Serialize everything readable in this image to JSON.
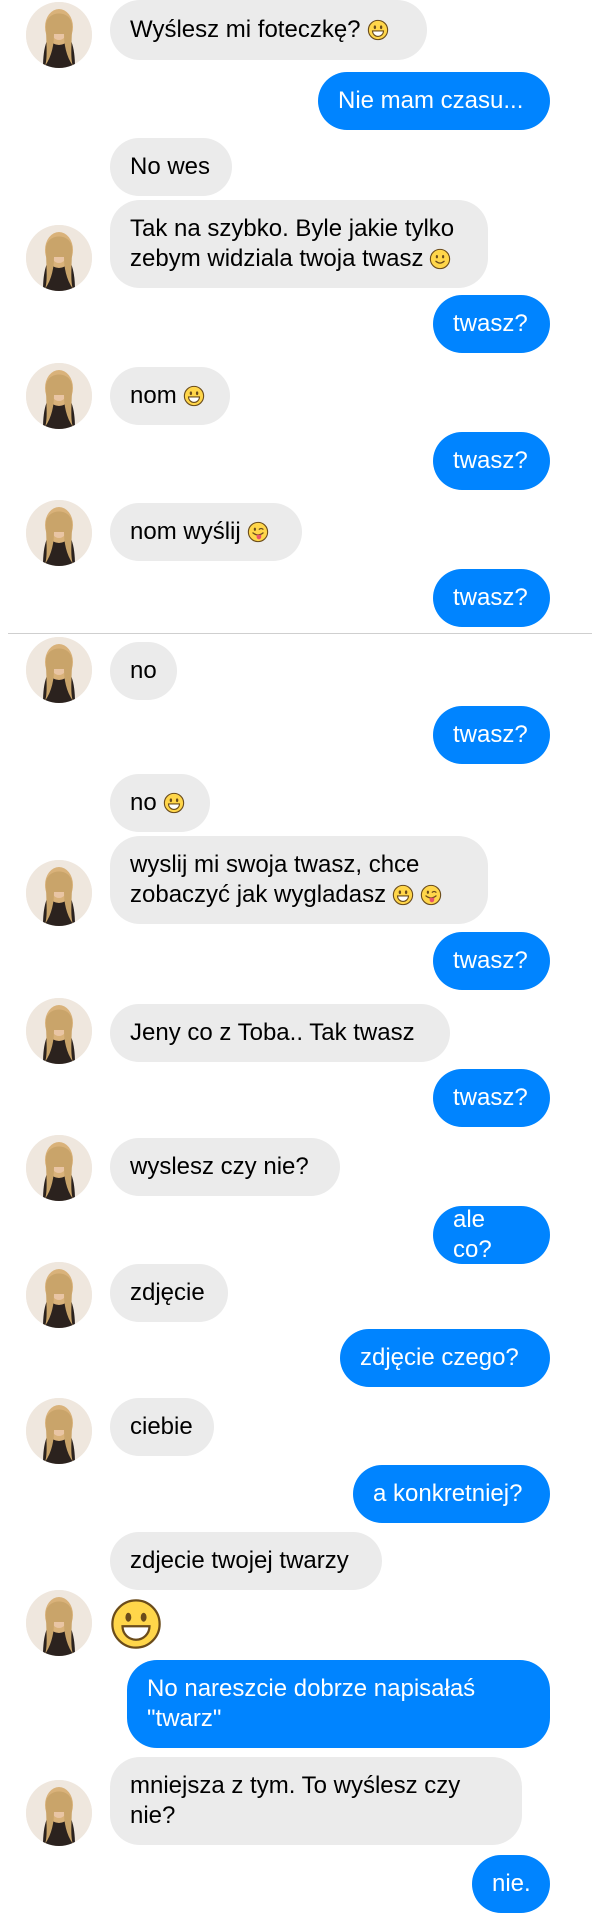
{
  "colors": {
    "incoming_bubble": "#ebebeb",
    "outgoing_bubble": "#0084ff",
    "incoming_text": "#000000",
    "outgoing_text": "#ffffff",
    "background": "#ffffff"
  },
  "messages": [
    {
      "id": "m1",
      "sender": "contact",
      "text": "Wyślesz mi foteczkę?",
      "emoji": [
        "grinning-face"
      ]
    },
    {
      "id": "m2",
      "sender": "me",
      "text": "Nie mam czasu..."
    },
    {
      "id": "m3",
      "sender": "contact",
      "text": "No wes"
    },
    {
      "id": "m4",
      "sender": "contact",
      "text": "Tak na szybko. Byle jakie tylko zebym widziala twoja twasz",
      "emoji": [
        "slightly-smiling-face"
      ]
    },
    {
      "id": "m5",
      "sender": "me",
      "text": "twasz?"
    },
    {
      "id": "m6",
      "sender": "contact",
      "text": "nom",
      "emoji": [
        "grinning-face"
      ]
    },
    {
      "id": "m7",
      "sender": "me",
      "text": "twasz?"
    },
    {
      "id": "m8",
      "sender": "contact",
      "text": "nom wyślij",
      "emoji": [
        "winking-tongue-face"
      ]
    },
    {
      "id": "m9",
      "sender": "me",
      "text": "twasz?"
    },
    {
      "id": "m10",
      "sender": "contact",
      "text": "no"
    },
    {
      "id": "m11",
      "sender": "me",
      "text": "twasz?"
    },
    {
      "id": "m12",
      "sender": "contact",
      "text": "no",
      "emoji": [
        "grinning-face"
      ]
    },
    {
      "id": "m13",
      "sender": "contact",
      "text": "wyslij mi swoja twasz, chce zobaczyć jak wygladasz",
      "emoji": [
        "grinning-face",
        "winking-tongue-face"
      ]
    },
    {
      "id": "m14",
      "sender": "me",
      "text": "twasz?"
    },
    {
      "id": "m15",
      "sender": "contact",
      "text": "Jeny co z Toba.. Tak twasz"
    },
    {
      "id": "m16",
      "sender": "me",
      "text": "twasz?"
    },
    {
      "id": "m17",
      "sender": "contact",
      "text": "wyslesz czy nie?"
    },
    {
      "id": "m18",
      "sender": "me",
      "text": "ale co?"
    },
    {
      "id": "m19",
      "sender": "contact",
      "text": "zdjęcie"
    },
    {
      "id": "m20",
      "sender": "me",
      "text": "zdjęcie czego?"
    },
    {
      "id": "m21",
      "sender": "contact",
      "text": "ciebie"
    },
    {
      "id": "m22",
      "sender": "me",
      "text": "a konkretniej?"
    },
    {
      "id": "m23",
      "sender": "contact",
      "text": "zdjecie twojej twarzy"
    },
    {
      "id": "m24",
      "sender": "contact",
      "text": "",
      "emoji": [
        "grinning-face"
      ],
      "big_emoji": true
    },
    {
      "id": "m25",
      "sender": "me",
      "text": "No nareszcie dobrze napisałaś \"twarz\""
    },
    {
      "id": "m26",
      "sender": "contact",
      "text": "mniejsza z tym. To wyślesz czy nie?"
    },
    {
      "id": "m27",
      "sender": "me",
      "text": "nie."
    }
  ]
}
